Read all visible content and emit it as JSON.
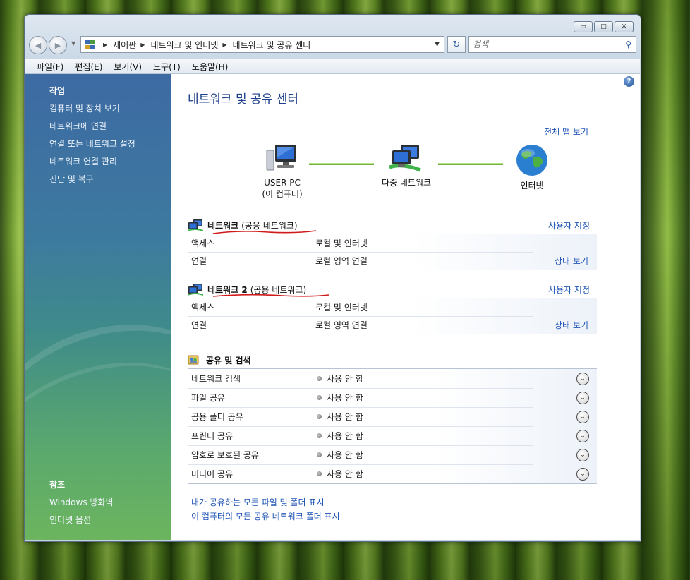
{
  "window": {
    "controls": {
      "minimize": "▭",
      "maximize": "□",
      "close": "✕"
    }
  },
  "nav": {
    "back_icon": "back-arrow-icon",
    "forward_icon": "forward-arrow-icon",
    "breadcrumbs": [
      "제어판",
      "네트워크 및 인터넷",
      "네트워크 및 공유 센터"
    ],
    "search_placeholder": "검색"
  },
  "menubar": [
    "파일(F)",
    "편집(E)",
    "보기(V)",
    "도구(T)",
    "도움말(H)"
  ],
  "sidebar": {
    "tasks_heading": "작업",
    "tasks": [
      "컴퓨터 및 장치 보기",
      "네트워크에 연결",
      "연결 또는 네트워크 설정",
      "네트워크 연결 관리",
      "진단 및 복구"
    ],
    "see_also_heading": "참조",
    "see_also": [
      "Windows 방화벽",
      "인터넷 옵션"
    ]
  },
  "main": {
    "title": "네트워크 및 공유 센터",
    "full_map_link": "전체 맵 보기",
    "map": {
      "computer_name": "USER-PC",
      "computer_sub": "(이 컴퓨터)",
      "middle": "다중 네트워크",
      "internet": "인터넷"
    },
    "networks": [
      {
        "name": "네트워크",
        "type": "(공용 네트워크)",
        "customize": "사용자 지정",
        "rows": [
          {
            "key": "액세스",
            "value": "로컬 및 인터넷",
            "link": ""
          },
          {
            "key": "연결",
            "value": "로컬 영역 연결",
            "link": "상태 보기"
          }
        ]
      },
      {
        "name": "네트워크  2",
        "type": "(공용 네트워크)",
        "customize": "사용자 지정",
        "rows": [
          {
            "key": "액세스",
            "value": "로컬 및 인터넷",
            "link": ""
          },
          {
            "key": "연결",
            "value": "로컬 영역 연결",
            "link": "상태 보기"
          }
        ]
      }
    ],
    "sharing": {
      "heading": "공유 및 검색",
      "items": [
        {
          "name": "네트워크 검색",
          "status": "사용 안 함"
        },
        {
          "name": "파일 공유",
          "status": "사용 안 함"
        },
        {
          "name": "공용 폴더 공유",
          "status": "사용 안 함"
        },
        {
          "name": "프린터 공유",
          "status": "사용 안 함"
        },
        {
          "name": "암호로 보호된 공유",
          "status": "사용 안 함"
        },
        {
          "name": "미디어 공유",
          "status": "사용 안 함"
        }
      ]
    },
    "bottom_links": [
      "내가 공유하는 모든 파일 및 폴더 표시",
      "이 컴퓨터의 모든 공유 네트워크 폴더 표시"
    ]
  },
  "colors": {
    "link": "#1f55b6",
    "title": "#1e3f8a",
    "annotation_red": "#d11a1a"
  }
}
